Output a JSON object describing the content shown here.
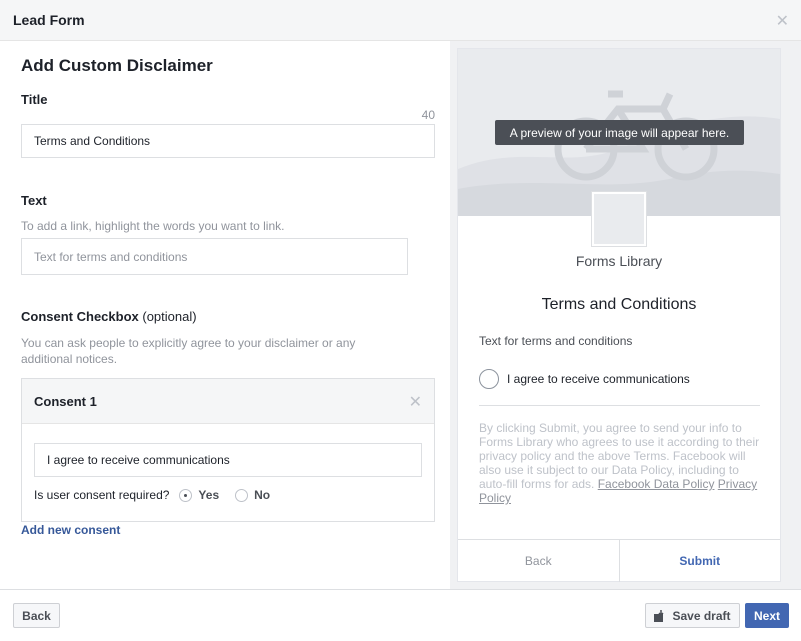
{
  "window": {
    "title": "Lead Form",
    "close_icon": "close-icon"
  },
  "editor": {
    "heading": "Add Custom Disclaimer",
    "title_section": {
      "label": "Title",
      "char_counter": "40",
      "value": "Terms and Conditions"
    },
    "text_section": {
      "label": "Text",
      "hint": "To add a link, highlight the words you want to link.",
      "placeholder": "Text for terms and conditions"
    },
    "consent_section": {
      "label": "Consent Checkbox",
      "optional": "(optional)",
      "hint": "You can ask people to explicitly agree to your disclaimer or any additional notices.",
      "consents": [
        {
          "header": "Consent 1",
          "value": "I agree to receive communications",
          "required_question": "Is user consent required?",
          "options": [
            "Yes",
            "No"
          ],
          "selected": "Yes"
        }
      ],
      "add_link": "Add new consent"
    }
  },
  "preview": {
    "image_tooltip": "A preview of your image will appear here.",
    "page_name": "Forms Library",
    "title": "Terms and Conditions",
    "text": "Text for terms and conditions",
    "consent_label": "I agree to receive communications",
    "legal_text": "By clicking Submit, you agree to send your info to Forms Library who agrees to use it according to their privacy policy and the above Terms. Facebook will also use it subject to our Data Policy, including to auto-fill forms for ads.",
    "legal_link_1": "Facebook Data Policy",
    "legal_link_2": "Privacy Policy",
    "back_label": "Back",
    "submit_label": "Submit"
  },
  "footer": {
    "back_label": "Back",
    "save_draft_label": "Save draft",
    "save_draft_icon": "save-draft-icon",
    "next_label": "Next"
  },
  "colors": {
    "primary_blue": "#4267b2",
    "link_blue": "#365899",
    "placeholder_gray": "#90949c"
  }
}
